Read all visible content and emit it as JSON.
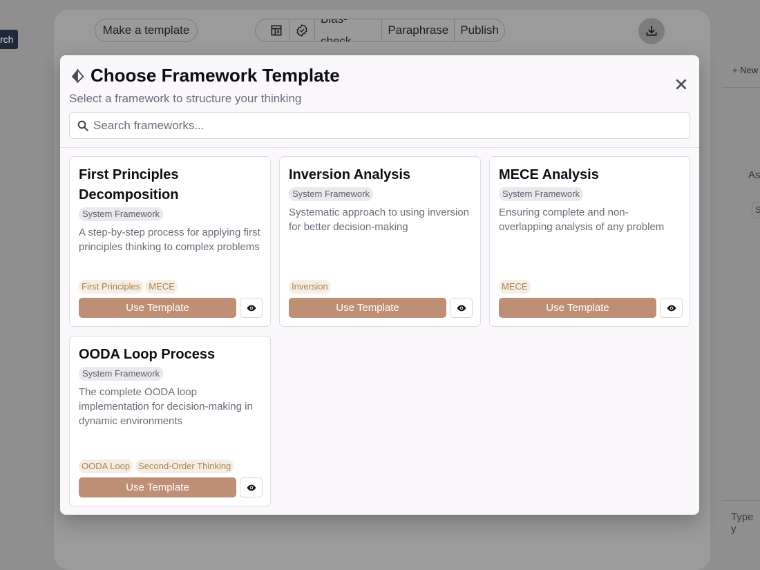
{
  "background": {
    "side_button_label": "rch",
    "make_template_label": "Make a template",
    "toolbar": {
      "icons": [
        "layout-icon",
        "badge-check-icon"
      ],
      "items": [
        {
          "label": "Bias-check"
        },
        {
          "label": "Paraphrase"
        },
        {
          "label": "Publish"
        }
      ]
    },
    "download_icon": "download-icon",
    "right_panel": {
      "new_label": "+ New",
      "partial_text": "As",
      "chip_text": "S",
      "input_placeholder": "Type y"
    }
  },
  "modal": {
    "icon": "framework-icon",
    "title": "Choose Framework Template",
    "subtitle": "Select a framework to structure your thinking",
    "search_placeholder": "Search frameworks...",
    "close_icon": "close-icon",
    "cards": [
      {
        "title": "First Principles Decomposition",
        "badge": "System Framework",
        "description": "A step-by-step process for applying first principles thinking to complex problems",
        "tags": [
          "First Principles",
          "MECE"
        ],
        "use_label": "Use Template"
      },
      {
        "title": "Inversion Analysis",
        "badge": "System Framework",
        "description": "Systematic approach to using inversion for better decision-making",
        "tags": [
          "Inversion"
        ],
        "use_label": "Use Template"
      },
      {
        "title": "MECE Analysis",
        "badge": "System Framework",
        "description": "Ensuring complete and non-overlapping analysis of any problem",
        "tags": [
          "MECE"
        ],
        "use_label": "Use Template"
      },
      {
        "title": "OODA Loop Process",
        "badge": "System Framework",
        "description": "The complete OODA loop implementation for decision-making in dynamic environments",
        "tags": [
          "OODA Loop",
          "Second-Order Thinking"
        ],
        "use_label": "Use Template"
      }
    ]
  },
  "colors": {
    "accent_button": "#bf8f75",
    "tag_text": "#a8824d",
    "tag_bg": "#f6eee5",
    "overlay": "#8f8f90"
  }
}
